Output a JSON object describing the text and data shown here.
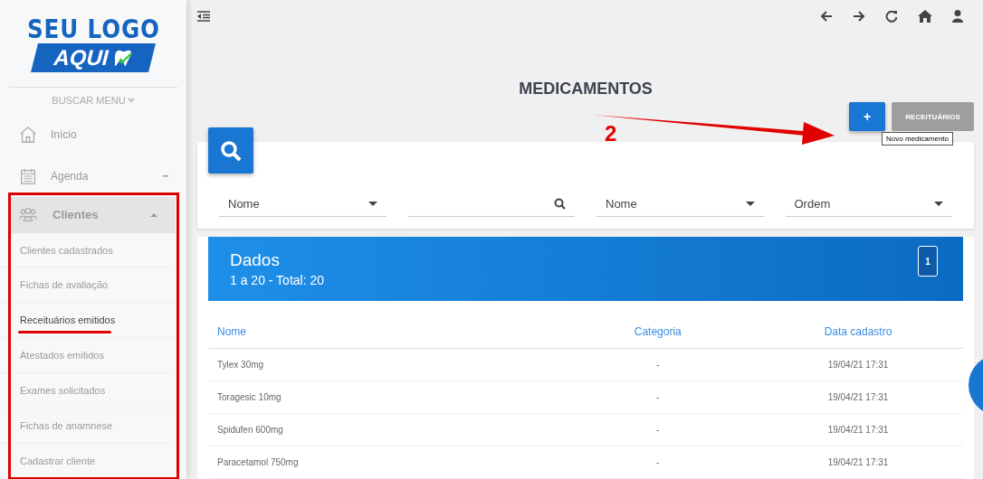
{
  "sidebar": {
    "logo": {
      "line1": "SEU LOGO",
      "line2": "AQUI"
    },
    "menu_search": "BUSCAR MENU",
    "items": [
      {
        "label": "Início",
        "kind": "home"
      },
      {
        "label": "Agenda",
        "kind": "calendar",
        "expanded": false
      },
      {
        "label": "Clientes",
        "kind": "people",
        "expanded": true,
        "children": [
          {
            "label": "Clientes cadastrados",
            "selected": false
          },
          {
            "label": "Fichas de avaliação",
            "selected": false
          },
          {
            "label": "Receituários emitidos",
            "selected": true
          },
          {
            "label": "Atestados emitidos",
            "selected": false
          },
          {
            "label": "Exames solicitados",
            "selected": false
          },
          {
            "label": "Fichas de anamnese",
            "selected": false
          },
          {
            "label": "Cadastrar cliente",
            "selected": false
          }
        ]
      }
    ]
  },
  "page_title": "MEDICAMENTOS",
  "actions": {
    "add": "+",
    "tooltip": "Novo medicamento",
    "prescriptions": "RECEITUÁRIOS"
  },
  "filters": [
    {
      "kind": "select",
      "value": "Nome"
    },
    {
      "kind": "search"
    },
    {
      "kind": "select",
      "value": "Nome"
    },
    {
      "kind": "select",
      "value": "Ordem"
    }
  ],
  "data_panel": {
    "title": "Dados",
    "summary": "1 a 20 - Total: 20",
    "page": "1"
  },
  "table": {
    "columns": [
      "Nome",
      "Categoria",
      "Data cadastro"
    ],
    "rows": [
      [
        "Tylex 30mg",
        "-",
        "19/04/21 17:31"
      ],
      [
        "Toragesic 10mg",
        "-",
        "19/04/21 17:31"
      ],
      [
        "Spidufen 600mg",
        "-",
        "19/04/21 17:31"
      ],
      [
        "Paracetamol 750mg",
        "-",
        "19/04/21 17:31"
      ]
    ]
  },
  "annotation": {
    "step": "2"
  }
}
